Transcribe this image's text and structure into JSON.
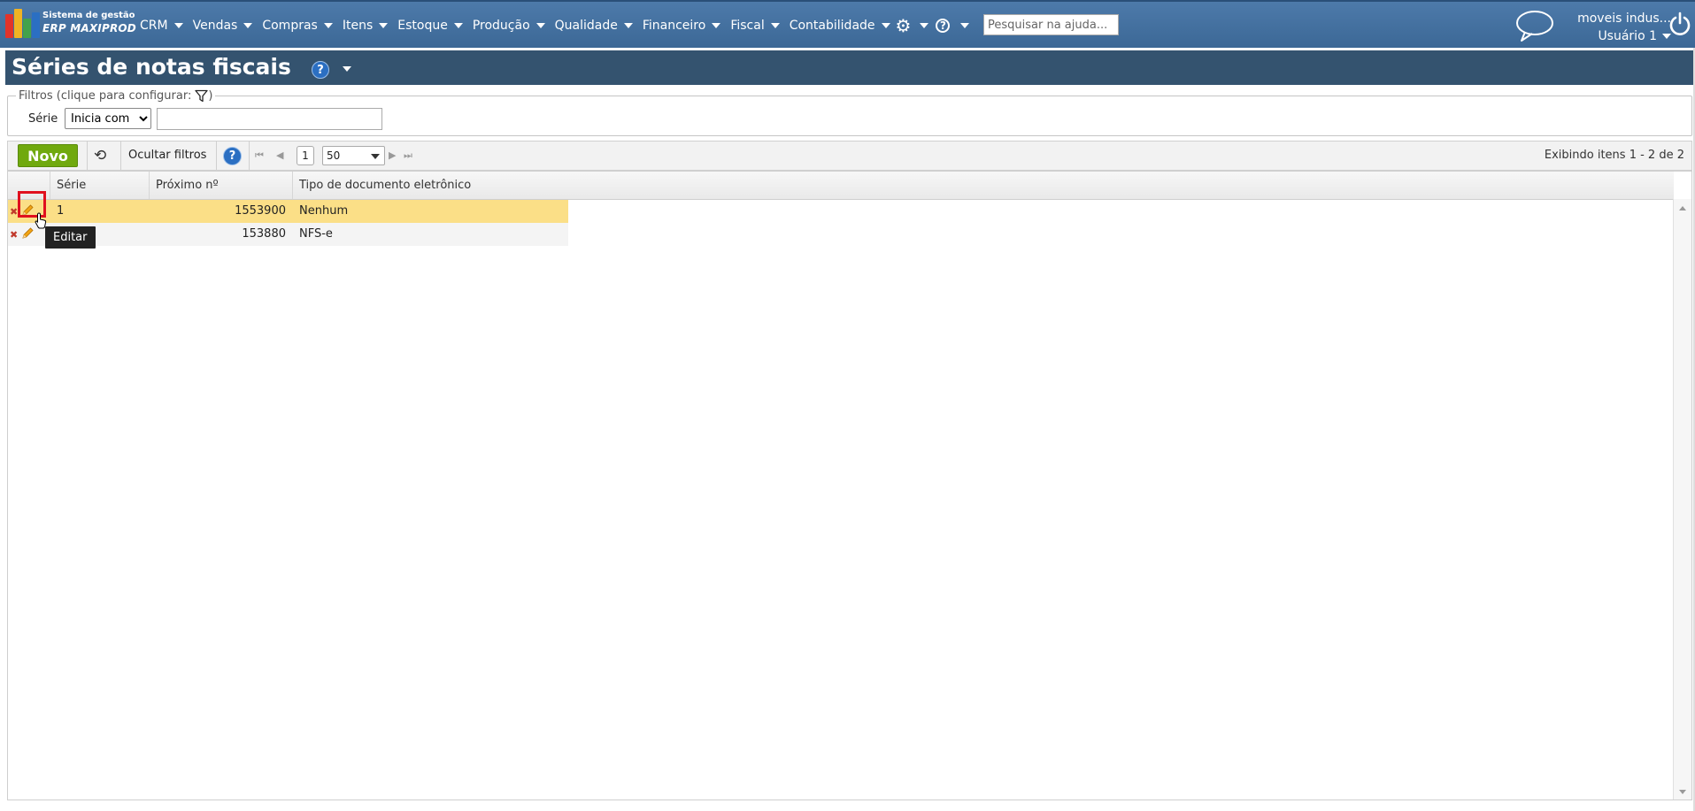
{
  "brand": {
    "line1": "Sistema de gestão",
    "line2": "ERP MAXIPROD",
    "logo_colors": [
      "#e2332a",
      "#f0b323",
      "#43a24b",
      "#2b6fc2"
    ]
  },
  "nav": {
    "items": [
      {
        "label": "CRM"
      },
      {
        "label": "Vendas"
      },
      {
        "label": "Compras"
      },
      {
        "label": "Itens"
      },
      {
        "label": "Estoque"
      },
      {
        "label": "Produção"
      },
      {
        "label": "Qualidade"
      },
      {
        "label": "Financeiro"
      },
      {
        "label": "Fiscal"
      },
      {
        "label": "Contabilidade"
      }
    ],
    "settings_icon": "gear-icon",
    "help_icon": "question-circle-icon",
    "help_search_placeholder": "Pesquisar na ajuda..."
  },
  "user": {
    "company": "moveis indus...",
    "name": "Usuário 1"
  },
  "page": {
    "title": "Séries de notas fiscais"
  },
  "filters": {
    "legend_open": "Filtros (clique para configurar:",
    "legend_close": ")",
    "field_label": "Série",
    "operator_options": [
      "Inicia com"
    ],
    "operator_selected": "Inicia com",
    "value": ""
  },
  "toolbar": {
    "new_label": "Novo",
    "hide_filters_label": "Ocultar filtros",
    "current_page": "1",
    "page_size": "50",
    "info": "Exibindo itens 1 - 2 de 2"
  },
  "grid": {
    "columns": [
      "Série",
      "Próximo nº",
      "Tipo de documento eletrônico"
    ],
    "rows": [
      {
        "serie": "1",
        "proximo": "1553900",
        "tipo": "Nenhum",
        "selected": true
      },
      {
        "serie": "",
        "proximo": "153880",
        "tipo": "NFS-e",
        "selected": false
      }
    ],
    "tooltip": "Editar",
    "selected_row_color": "#fbdf87"
  },
  "colors": {
    "topbar": "#4774a3",
    "header": "#34536f",
    "new_button": "#70a90e",
    "highlight": "#e0101e"
  }
}
